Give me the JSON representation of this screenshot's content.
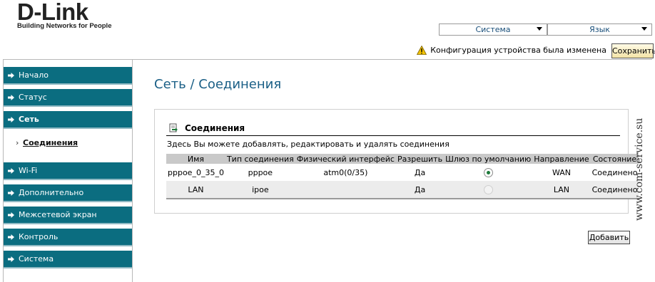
{
  "brand": {
    "logo": "D-Link",
    "tagline": "Building Networks for People"
  },
  "top_selects": [
    {
      "label": "Система"
    },
    {
      "label": "Язык"
    }
  ],
  "notice": {
    "text": "Конфигурация устройства была изменена",
    "icon": "warning-icon",
    "save_label": "Сохранить"
  },
  "sidebar": {
    "items": [
      {
        "label": "Начало"
      },
      {
        "label": "Статус"
      },
      {
        "label": "Сеть"
      },
      {
        "label": "Wi-Fi"
      },
      {
        "label": "Дополнительно"
      },
      {
        "label": "Межсетевой экран"
      },
      {
        "label": "Контроль"
      },
      {
        "label": "Система"
      }
    ],
    "active_submenu": {
      "bullet": "›",
      "label": "Соединения"
    }
  },
  "page": {
    "title": "Сеть /  Соединения",
    "section_title": "Соединения",
    "description": "Здесь Вы можете добавлять, редактировать и удалять соединения",
    "table": {
      "headers": [
        "Имя",
        "Тип соединения",
        "Физический интерфейс",
        "Разрешить",
        "Шлюз по умолчанию",
        "Направление",
        "Состояние"
      ],
      "rows": [
        {
          "name": "pppoe_0_35_0",
          "type": "pppoe",
          "iface": "atm0(0/35)",
          "enabled": "Да",
          "default_gw": true,
          "direction": "WAN",
          "status": "Соединено"
        },
        {
          "name": "LAN",
          "type": "ipoe",
          "iface": "",
          "enabled": "Да",
          "default_gw": false,
          "direction": "LAN",
          "status": "Соединено"
        }
      ]
    },
    "add_label": "Добавить"
  },
  "watermark": "www.com-service.su",
  "colors": {
    "menu_bg": "#0b6d80",
    "title": "#1a5f86",
    "radio_checked": "#1d7a3a"
  }
}
